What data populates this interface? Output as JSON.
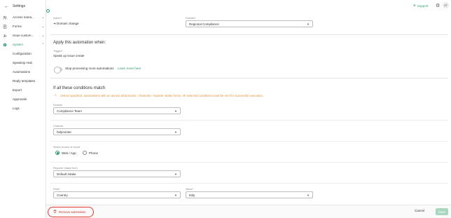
{
  "sidebar": {
    "header": "Settings",
    "items": [
      {
        "label": "Access mana...",
        "icon": "people-icon"
      },
      {
        "label": "Forms",
        "icon": "form-icon"
      },
      {
        "label": "Issue custom...",
        "icon": "wrench-icon"
      },
      {
        "label": "System",
        "icon": "gear-icon"
      }
    ],
    "sub_items": [
      "Configuration",
      "SpeakUp Hub",
      "Automations",
      "Reply templates",
      "Export",
      "Approvals",
      "Logs"
    ]
  },
  "topbar": {
    "support_label": "Support",
    "avatar_initials": "JT"
  },
  "action_section": {
    "action_label": "Action*",
    "action_value": "Domain change",
    "domain_label": "Domain*",
    "domain_value": "Regional Compliance"
  },
  "apply_section": {
    "heading": "Apply this automation when:",
    "trigger_label": "Trigger*",
    "trigger_value": "Speak up issue create",
    "toggle_label": "Stop processing more automations",
    "learn_more": "Learn more here"
  },
  "conditions": {
    "heading": "If all these conditions match",
    "warning": "Unless specified, automations will run across all domains / channels / reporter intake forms. All selected conditions must be met for successful execution.",
    "domain_label": "Domain",
    "domain_value": "Compliance Team",
    "channel_label": "Channel",
    "channel_value": "helpcenter",
    "source_label": "Select source of report",
    "source_options": [
      "Web / App",
      "Phone"
    ],
    "intake_label": "Reporter intake form",
    "intake_value": "Default intake",
    "field_label": "Field*",
    "field_value": "Country",
    "value_label": "Value*",
    "value_value": "Italy"
  },
  "footer": {
    "remove_label": "Remove automation",
    "cancel_label": "Cancel",
    "save_label": "Save"
  },
  "colors": {
    "accent": "#2e9d6b",
    "warning": "#e0913a",
    "danger": "#e53935"
  }
}
